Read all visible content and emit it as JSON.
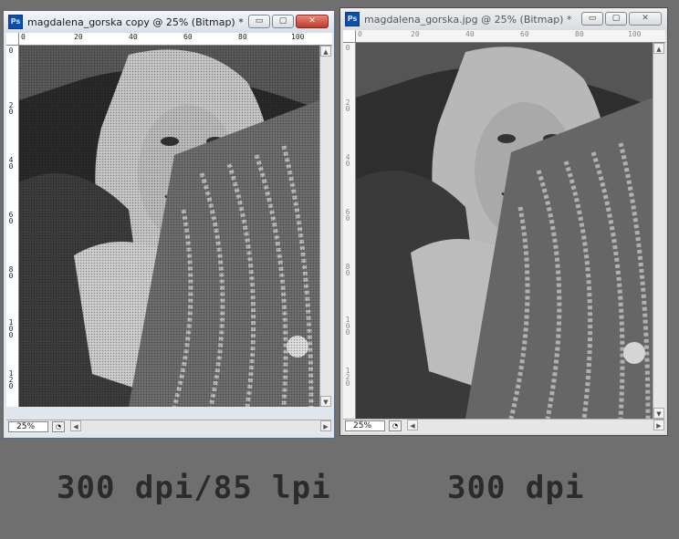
{
  "windows": [
    {
      "title": "magdalena_gorska copy @ 25% (Bitmap) *",
      "app_icon": "Ps",
      "zoom": "25%",
      "ruler_h": [
        "0",
        "20",
        "40",
        "60",
        "80",
        "100"
      ],
      "ruler_v": [
        "0",
        "2\n0",
        "4\n0",
        "6\n0",
        "8\n0",
        "1\n0\n0",
        "1\n2\n0"
      ],
      "controls": {
        "minimize": "▭",
        "maximize": "▢",
        "close": "✕"
      }
    },
    {
      "title": "magdalena_gorska.jpg @ 25% (Bitmap) *",
      "app_icon": "Ps",
      "zoom": "25%",
      "ruler_h": [
        "0",
        "20",
        "40",
        "60",
        "80",
        "100"
      ],
      "ruler_v": [
        "0",
        "2\n0",
        "4\n0",
        "6\n0",
        "8\n0",
        "1\n0\n0",
        "1\n2\n0"
      ],
      "controls": {
        "minimize": "▭",
        "maximize": "▢",
        "close": "✕"
      }
    }
  ],
  "captions": {
    "left": "300 dpi/85 lpi",
    "right": "300 dpi"
  },
  "colors": {
    "desktop": "#6f6f6f",
    "caption": "#2b2b2b"
  }
}
